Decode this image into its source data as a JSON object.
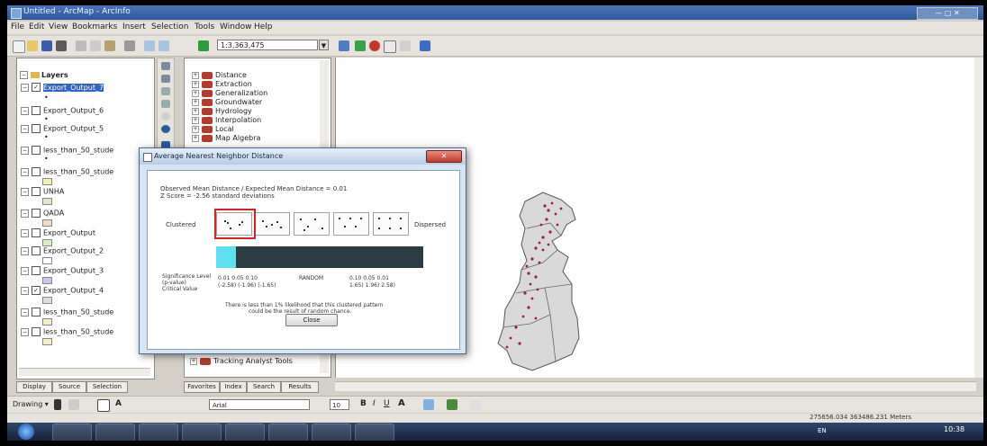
{
  "title_bar": {
    "text": "Untitled - ArcMap - ArcInfo",
    "window_controls": "— ▢ ✕"
  },
  "menu": [
    "File",
    "Edit",
    "View",
    "Bookmarks",
    "Insert",
    "Selection",
    "Tools",
    "Window",
    "Help"
  ],
  "toolbar": {
    "scale": "1:3,363,475"
  },
  "toc": {
    "root": "Layers",
    "layers": [
      {
        "label": "Export_Output_7",
        "checked": true,
        "selected": true,
        "symbol": "dot"
      },
      {
        "label": "Export_Output_6",
        "checked": false,
        "selected": false,
        "symbol": "dot"
      },
      {
        "label": "Export_Output_5",
        "checked": false,
        "selected": false,
        "symbol": "dot"
      },
      {
        "label": "less_than_50_stude",
        "checked": false,
        "selected": false,
        "symbol": "dot"
      },
      {
        "label": "less_than_50_stude",
        "checked": false,
        "selected": false,
        "symbol": "box"
      },
      {
        "label": "UNHA",
        "checked": false,
        "selected": false,
        "symbol": "box"
      },
      {
        "label": "QADA",
        "checked": false,
        "selected": false,
        "symbol": "box"
      },
      {
        "label": "Export_Output",
        "checked": false,
        "selected": false,
        "symbol": "box"
      },
      {
        "label": "Export_Output_2",
        "checked": false,
        "selected": false,
        "symbol": "box"
      },
      {
        "label": "Export_Output_3",
        "checked": false,
        "selected": false,
        "symbol": "box"
      },
      {
        "label": "Export_Output_4",
        "checked": true,
        "selected": false,
        "symbol": "box"
      },
      {
        "label": "less_than_50_stude",
        "checked": false,
        "selected": false,
        "symbol": "box"
      },
      {
        "label": "less_than_50_stude",
        "checked": false,
        "selected": false,
        "symbol": "box"
      }
    ],
    "tabs": [
      "Display",
      "Source",
      "Selection"
    ]
  },
  "atb": {
    "items": [
      "Distance",
      "Extraction",
      "Generalization",
      "Groundwater",
      "Hydrology",
      "Interpolation",
      "Local",
      "Map Algebra"
    ],
    "bottom_item": "Tracking Analyst Tools",
    "tabs": [
      "Favorites",
      "Index",
      "Search",
      "Results"
    ]
  },
  "dialog": {
    "title": "Average Nearest Neighbor Distance",
    "close_label": "✕",
    "ratio_text": "Observed Mean Distance / Expected Mean Distance = 0.01",
    "zscore_text": "Z Score = -2.56 standard deviations",
    "clustered_label": "Clustered",
    "dispersed_label": "Dispersed",
    "sig_label_1": "Significance Level",
    "sig_label_2": "(p-value)",
    "crit_label": "Critical Value",
    "sig_left": "0.01    0.05    0.10",
    "crit_left": "(-2.58)  (-1.96)  (-1.65)",
    "random_label": "RANDOM",
    "sig_right": "0.10    0.05    0.01",
    "crit_right": "1.65)   1.96)   2.58)",
    "note_line1": "There is less than 1% likelihood that this clustered pattern",
    "note_line2": "could be the result of random chance.",
    "button_label": "Close",
    "highlight_color": "#e02020",
    "bar_color": "#2b3c45",
    "cyan_color": "#5fe0f0"
  },
  "drawing": {
    "label": "Drawing ▾",
    "font": "Arial",
    "size": "10"
  },
  "status": {
    "coords": "275656.034  363486.231 Meters"
  },
  "taskbar": {
    "clock_time": "10:38",
    "clock_lang": "EN"
  }
}
